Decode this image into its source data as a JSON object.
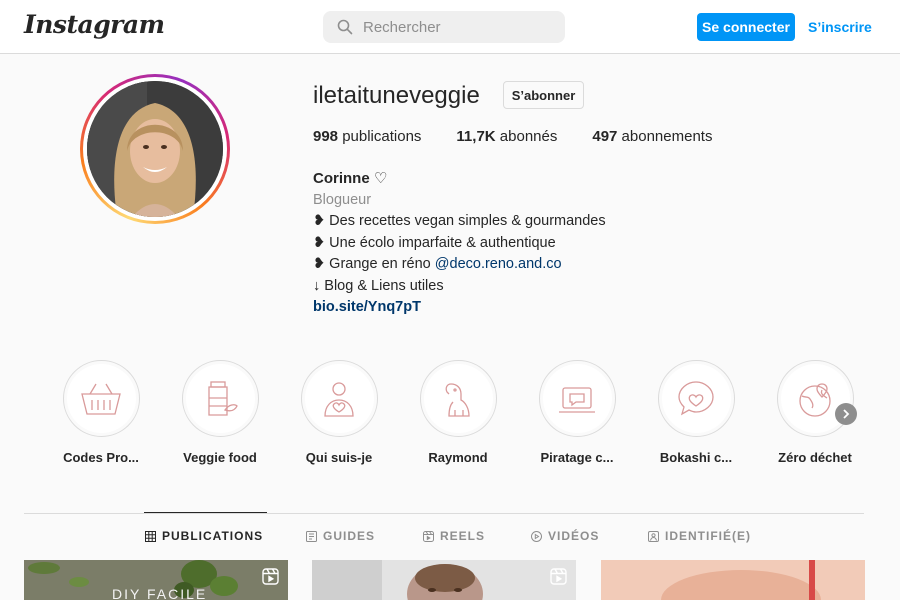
{
  "header": {
    "logo_text": "Instagram",
    "search_placeholder": "Rechercher",
    "login_label": "Se connecter",
    "signup_label": "S’inscrire"
  },
  "profile": {
    "username": "iletaituneveggie",
    "follow_label": "S’abonner",
    "stats": [
      {
        "value": "998",
        "label": " publications"
      },
      {
        "value": "11,7K",
        "label": " abonnés"
      },
      {
        "value": "497",
        "label": " abonnements"
      }
    ],
    "full_name": "Corinne ♡",
    "category": "Blogueur",
    "bio_lines": [
      "❥ Des recettes vegan simples & gourmandes",
      "❥ Une écolo imparfaite & authentique"
    ],
    "bio_line3_prefix": "❥ Grange en réno ",
    "bio_mention": "@deco.reno.and.co",
    "bio_line4": "↓ Blog & Liens utiles",
    "bio_link": "bio.site/Ynq7pT"
  },
  "highlights": [
    {
      "label": "Codes Pro...",
      "icon": "basket-icon"
    },
    {
      "label": "Veggie food",
      "icon": "jar-icon"
    },
    {
      "label": "Qui suis-je",
      "icon": "person-heart-icon"
    },
    {
      "label": "Raymond",
      "icon": "dog-icon"
    },
    {
      "label": "Piratage c...",
      "icon": "laptop-chat-icon"
    },
    {
      "label": "Bokashi c...",
      "icon": "heart-bubble-icon"
    },
    {
      "label": "Zéro déchet",
      "icon": "globe-icon"
    }
  ],
  "tabs": [
    {
      "label": "PUBLICATIONS",
      "icon": "grid-icon",
      "active": true
    },
    {
      "label": "GUIDES",
      "icon": "guide-icon",
      "active": false
    },
    {
      "label": "REELS",
      "icon": "reels-icon",
      "active": false
    },
    {
      "label": "VIDÉOS",
      "icon": "play-icon",
      "active": false
    },
    {
      "label": "IDENTIFIÉ(E)",
      "icon": "tag-icon",
      "active": false
    }
  ],
  "posts": [
    {
      "overlay_text": "DIY FACILE",
      "icon": "reel-icon"
    },
    {
      "overlay_text": "",
      "icon": "reel-icon"
    },
    {
      "overlay_text": "",
      "icon": ""
    }
  ],
  "colors": {
    "accent": "#0095f6",
    "link": "#00376b",
    "highlight_line": "#d99a9a"
  }
}
